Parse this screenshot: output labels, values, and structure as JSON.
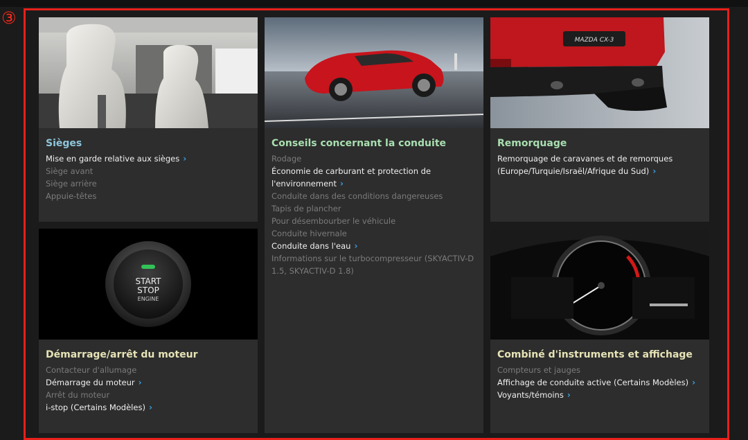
{
  "marker": "③",
  "cards": {
    "seats": {
      "title": "Sièges",
      "items": [
        {
          "label": "Mise en garde relative aux sièges",
          "link": true
        },
        {
          "label": "Siège avant",
          "link": false
        },
        {
          "label": "Siège arrière",
          "link": false
        },
        {
          "label": "Appuie-têtes",
          "link": false
        }
      ]
    },
    "driving": {
      "title": "Conseils concernant la conduite",
      "items": [
        {
          "label": "Rodage",
          "link": false
        },
        {
          "label": "Économie de carburant et protection de l'environnement",
          "link": true
        },
        {
          "label": "Conduite dans des conditions dangereuses",
          "link": false
        },
        {
          "label": "Tapis de plancher",
          "link": false
        },
        {
          "label": "Pour désembourber le véhicule",
          "link": false
        },
        {
          "label": "Conduite hivernale",
          "link": false
        },
        {
          "label": "Conduite dans l'eau",
          "link": true
        },
        {
          "label": "Informations sur le turbocompresseur (SKYACTIV-D 1.5, SKYACTIV-D 1.8)",
          "link": false
        }
      ]
    },
    "towing": {
      "title": "Remorquage",
      "items": [
        {
          "label": "Remorquage de caravanes et de remorques (Europe/Turquie/Israël/Afrique du Sud)",
          "link": true
        }
      ]
    },
    "engine": {
      "title": "Démarrage/arrêt du moteur",
      "button_lines": [
        "START",
        "STOP",
        "ENGINE"
      ],
      "items": [
        {
          "label": "Contacteur d'allumage",
          "link": false
        },
        {
          "label": "Démarrage du moteur",
          "link": true
        },
        {
          "label": "Arrêt du moteur",
          "link": false
        },
        {
          "label": "i-stop (Certains Modèles)",
          "link": true
        }
      ]
    },
    "cluster": {
      "title": "Combiné d'instruments et affichage",
      "items": [
        {
          "label": "Compteurs et jauges",
          "link": false
        },
        {
          "label": "Affichage de conduite active (Certains Modèles)",
          "link": true
        },
        {
          "label": "Voyants/témoins",
          "link": true
        }
      ]
    }
  },
  "car_badge": "MAZDA CX-3",
  "colors": {
    "frame": "#e8201a",
    "chevron": "#3aa0e0",
    "card": "#2d2d2d"
  }
}
